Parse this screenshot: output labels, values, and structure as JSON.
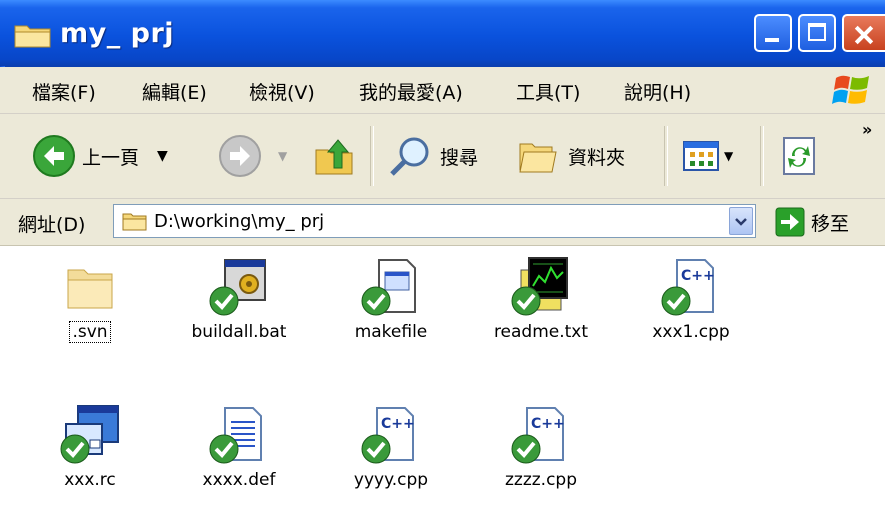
{
  "window": {
    "title": "my_ prj"
  },
  "menu": [
    "檔案(F)",
    "編輯(E)",
    "檢視(V)",
    "我的最愛(A)",
    "工具(T)",
    "說明(H)"
  ],
  "toolbar": {
    "back_label": "上一頁",
    "search_label": "搜尋",
    "folders_label": "資料夾",
    "more_chevron": "»"
  },
  "address": {
    "label": "網址(D)",
    "value": "D:\\working\\my_ prj",
    "go_label": "移至"
  },
  "files": [
    {
      "name": ".svn",
      "icon": "folder-icon",
      "versioned": false
    },
    {
      "name": "buildall.bat",
      "icon": "batch-file-icon",
      "versioned": true
    },
    {
      "name": "makefile",
      "icon": "generic-file-icon",
      "versioned": true
    },
    {
      "name": "readme.txt",
      "icon": "chart-file-icon",
      "versioned": true
    },
    {
      "name": "xxx1.cpp",
      "icon": "cpp-file-icon",
      "versioned": true
    },
    {
      "name": "xxx.rc",
      "icon": "resource-file-icon",
      "versioned": true
    },
    {
      "name": "xxxx.def",
      "icon": "text-document-icon",
      "versioned": true
    },
    {
      "name": "yyyy.cpp",
      "icon": "cpp-file-icon",
      "versioned": true
    },
    {
      "name": "zzzz.cpp",
      "icon": "cpp-file-icon",
      "versioned": true
    }
  ],
  "colors": {
    "titlebar": "#0a52dd",
    "chrome": "#ece9d8",
    "svn_check": "#3a9a3a"
  }
}
